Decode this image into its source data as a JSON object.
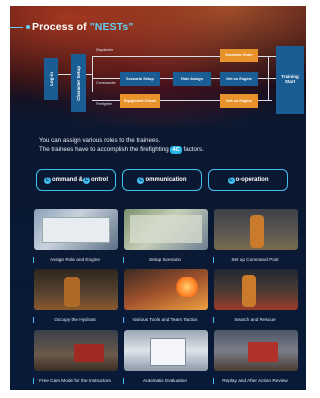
{
  "title": {
    "prefix": "Process of ",
    "highlight": "\"NESTs\""
  },
  "flowchart": {
    "log_in": "Log-in",
    "character_setup": "Character Setup",
    "roles": {
      "dispatcher": "Dispatcher",
      "commander": "Commander",
      "firefighter": "Firefighter"
    },
    "steps": {
      "scenario_setup": "Scenario Setup",
      "role_assign": "Role Assign",
      "get_on_engine_top": "Get on Engine",
      "equipment_check": "Equipment Check",
      "get_on_engine_bottom": "Get on Engine",
      "scenario_order": "Scenario Order"
    },
    "training_start": "Training Start"
  },
  "description": {
    "line1": "You can assign various roles to the trainees.",
    "line2_pre": "The trainees have to accomplish the firefighting ",
    "badge": "4C",
    "line2_post": " factors."
  },
  "factor_buttons": [
    {
      "label": "ommand & ",
      "letter": "C",
      "letter2": "C",
      "label2": "ontrol"
    },
    {
      "letter": "C",
      "label": "ommunication"
    },
    {
      "letter": "C",
      "label": "o-operation"
    }
  ],
  "features": [
    {
      "caption": "Assign Role and Engine"
    },
    {
      "caption": "Setup Scenario"
    },
    {
      "caption": "Set up Command Post"
    },
    {
      "caption": "Occupy the Hydrant"
    },
    {
      "caption": "Various Tools and Team Tactics"
    },
    {
      "caption": "Search and Rescue"
    },
    {
      "caption": "Free Cam Mode for the Instructors"
    },
    {
      "caption": "Automatic Evaluation"
    },
    {
      "caption": "Replay and After Action Review"
    }
  ],
  "colors": {
    "accent": "#42bdf0",
    "flow_blue": "#1a5d95",
    "flow_orange": "#e8922b"
  }
}
